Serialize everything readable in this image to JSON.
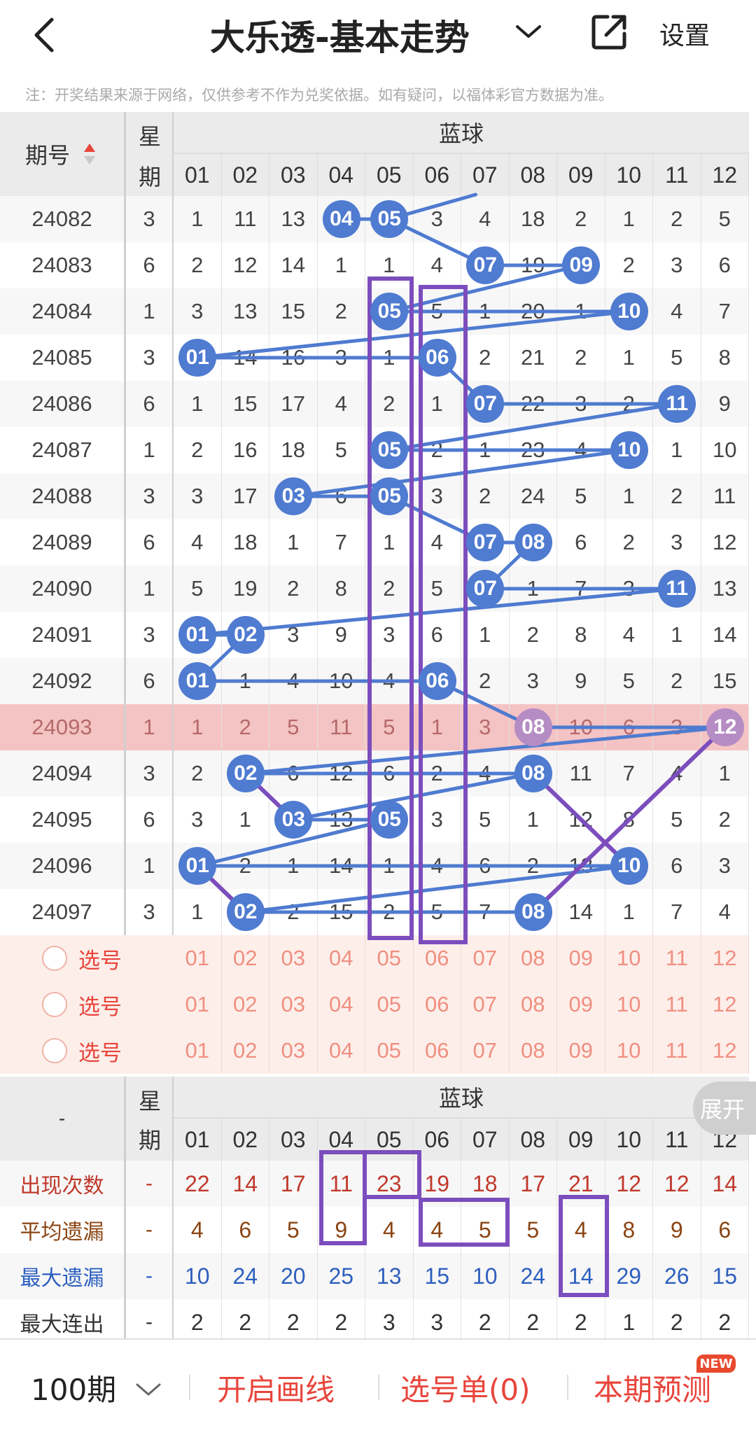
{
  "header": {
    "title": "大乐透-基本走势",
    "settings_label": "设置"
  },
  "notice": "注：开奖结果来源于网络，仅供参考不作为兑奖依据。如有疑问，以福体彩官方数据为准。",
  "table": {
    "col_issue": "期号",
    "col_weekday": [
      "星",
      "期"
    ],
    "blue_group_label": "蓝球",
    "blue_cols": [
      "01",
      "02",
      "03",
      "04",
      "05",
      "06",
      "07",
      "08",
      "09",
      "10",
      "11",
      "12"
    ],
    "rows": [
      {
        "issue": "24082",
        "weekday": "3",
        "cells": [
          "1",
          "11",
          "13",
          "04",
          "05",
          "3",
          "4",
          "18",
          "2",
          "1",
          "2",
          "5"
        ],
        "hit": [
          4,
          5
        ]
      },
      {
        "issue": "24083",
        "weekday": "6",
        "cells": [
          "2",
          "12",
          "14",
          "1",
          "1",
          "4",
          "07",
          "19",
          "09",
          "2",
          "3",
          "6"
        ],
        "hit": [
          7,
          9
        ]
      },
      {
        "issue": "24084",
        "weekday": "1",
        "cells": [
          "3",
          "13",
          "15",
          "2",
          "05",
          "5",
          "1",
          "20",
          "1",
          "10",
          "4",
          "7"
        ],
        "hit": [
          5,
          10
        ]
      },
      {
        "issue": "24085",
        "weekday": "3",
        "cells": [
          "01",
          "14",
          "16",
          "3",
          "1",
          "06",
          "2",
          "21",
          "2",
          "1",
          "5",
          "8"
        ],
        "hit": [
          1,
          6
        ]
      },
      {
        "issue": "24086",
        "weekday": "6",
        "cells": [
          "1",
          "15",
          "17",
          "4",
          "2",
          "1",
          "07",
          "22",
          "3",
          "2",
          "11",
          "9"
        ],
        "hit": [
          7,
          11
        ]
      },
      {
        "issue": "24087",
        "weekday": "1",
        "cells": [
          "2",
          "16",
          "18",
          "5",
          "05",
          "2",
          "1",
          "23",
          "4",
          "10",
          "1",
          "10"
        ],
        "hit": [
          5,
          10
        ]
      },
      {
        "issue": "24088",
        "weekday": "3",
        "cells": [
          "3",
          "17",
          "03",
          "6",
          "05",
          "3",
          "2",
          "24",
          "5",
          "1",
          "2",
          "11"
        ],
        "hit": [
          3,
          5
        ]
      },
      {
        "issue": "24089",
        "weekday": "6",
        "cells": [
          "4",
          "18",
          "1",
          "7",
          "1",
          "4",
          "07",
          "08",
          "6",
          "2",
          "3",
          "12"
        ],
        "hit": [
          7,
          8
        ]
      },
      {
        "issue": "24090",
        "weekday": "1",
        "cells": [
          "5",
          "19",
          "2",
          "8",
          "2",
          "5",
          "07",
          "1",
          "7",
          "3",
          "11",
          "13"
        ],
        "hit": [
          7,
          11
        ]
      },
      {
        "issue": "24091",
        "weekday": "3",
        "cells": [
          "01",
          "02",
          "3",
          "9",
          "3",
          "6",
          "1",
          "2",
          "8",
          "4",
          "1",
          "14"
        ],
        "hit": [
          1,
          2
        ]
      },
      {
        "issue": "24092",
        "weekday": "6",
        "cells": [
          "01",
          "1",
          "4",
          "10",
          "4",
          "06",
          "2",
          "3",
          "9",
          "5",
          "2",
          "15"
        ],
        "hit": [
          1,
          6
        ]
      },
      {
        "issue": "24093",
        "weekday": "1",
        "cells": [
          "1",
          "2",
          "5",
          "11",
          "5",
          "1",
          "3",
          "08",
          "10",
          "6",
          "3",
          "12"
        ],
        "hit": [
          8,
          12
        ]
      },
      {
        "issue": "24094",
        "weekday": "3",
        "cells": [
          "2",
          "02",
          "6",
          "12",
          "6",
          "2",
          "4",
          "08",
          "11",
          "7",
          "4",
          "1"
        ],
        "hit": [
          2,
          8
        ]
      },
      {
        "issue": "24095",
        "weekday": "6",
        "cells": [
          "3",
          "1",
          "03",
          "13",
          "05",
          "3",
          "5",
          "1",
          "12",
          "8",
          "5",
          "2"
        ],
        "hit": [
          3,
          5
        ]
      },
      {
        "issue": "24096",
        "weekday": "1",
        "cells": [
          "01",
          "2",
          "1",
          "14",
          "1",
          "4",
          "6",
          "2",
          "13",
          "10",
          "6",
          "3"
        ],
        "hit": [
          1,
          10
        ]
      },
      {
        "issue": "24097",
        "weekday": "3",
        "cells": [
          "1",
          "02",
          "2",
          "15",
          "2",
          "5",
          "7",
          "08",
          "14",
          "1",
          "7",
          "4"
        ],
        "hit": [
          2,
          8
        ]
      }
    ],
    "pick_rows": [
      {
        "label": "选号"
      },
      {
        "label": "选号"
      },
      {
        "label": "选号"
      }
    ],
    "pick_numbers": [
      "01",
      "02",
      "03",
      "04",
      "05",
      "06",
      "07",
      "08",
      "09",
      "10",
      "11",
      "12"
    ]
  },
  "stats": {
    "corner": "-",
    "blue_group_label": "蓝球",
    "col_weekday": [
      "星",
      "期"
    ],
    "blue_cols": [
      "01",
      "02",
      "03",
      "04",
      "05",
      "06",
      "07",
      "08",
      "09",
      "10",
      "11",
      "12"
    ],
    "rows": [
      {
        "label": "出现次数",
        "dash": "-",
        "values": [
          "22",
          "14",
          "17",
          "11",
          "23",
          "19",
          "18",
          "17",
          "21",
          "12",
          "12",
          "14"
        ],
        "color": "#c0392b"
      },
      {
        "label": "平均遗漏",
        "dash": "-",
        "values": [
          "4",
          "6",
          "5",
          "9",
          "4",
          "4",
          "5",
          "5",
          "4",
          "8",
          "9",
          "6"
        ],
        "color": "#8b4513"
      },
      {
        "label": "最大遗漏",
        "dash": "-",
        "values": [
          "10",
          "24",
          "20",
          "25",
          "13",
          "15",
          "10",
          "24",
          "14",
          "29",
          "26",
          "15"
        ],
        "color": "#2c5fbf"
      },
      {
        "label": "最大连出",
        "dash": "-",
        "values": [
          "2",
          "2",
          "2",
          "2",
          "3",
          "3",
          "2",
          "2",
          "2",
          "1",
          "2",
          "2"
        ],
        "color": "#333333"
      }
    ],
    "expand_label": "展开"
  },
  "bottom": {
    "period_label": "100期",
    "draw_line_label": "开启画线",
    "pick_list_label": "选号单(0)",
    "predict_label": "本期预测",
    "new_badge": "NEW"
  },
  "colors": {
    "accent_red": "#e8453c",
    "ball_blue": "#4f7bd0",
    "line_blue": "#4f7bd0",
    "annot_purple": "#7c4dbd",
    "highlight_row": "#f4c3c3",
    "pick_bg": "#fdeeea"
  }
}
